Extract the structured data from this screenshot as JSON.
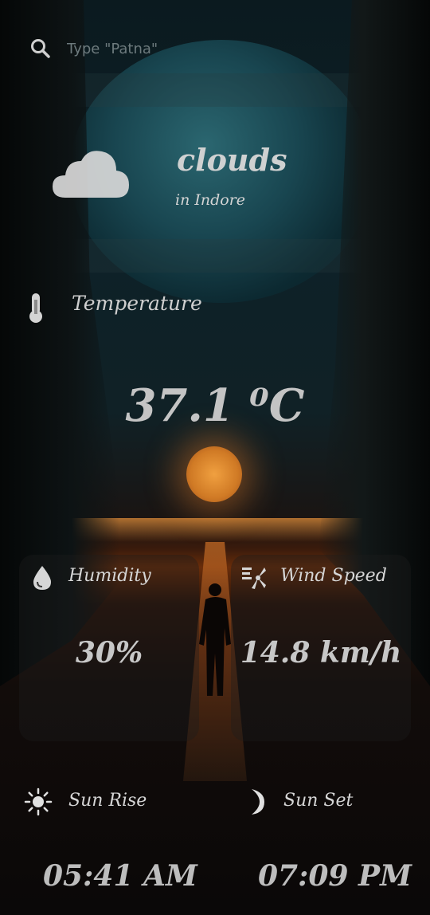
{
  "search": {
    "placeholder": "Type \"Patna\"",
    "icon": "search-icon"
  },
  "weather": {
    "condition": "clouds",
    "location": "in Indore",
    "icon": "cloud-icon"
  },
  "temperature": {
    "label": "Temperature",
    "value": "37.1 ⁰C",
    "icon": "thermometer-icon"
  },
  "humidity": {
    "label": "Humidity",
    "value": "30%",
    "icon": "droplet-icon"
  },
  "wind": {
    "label": "Wind Speed",
    "value": "14.8 km/h",
    "icon": "wind-icon"
  },
  "sunrise": {
    "label": "Sun Rise",
    "time": "05:41 AM",
    "icon": "sun-icon"
  },
  "sunset": {
    "label": "Sun Set",
    "time": "07:09 PM",
    "icon": "moon-icon"
  }
}
